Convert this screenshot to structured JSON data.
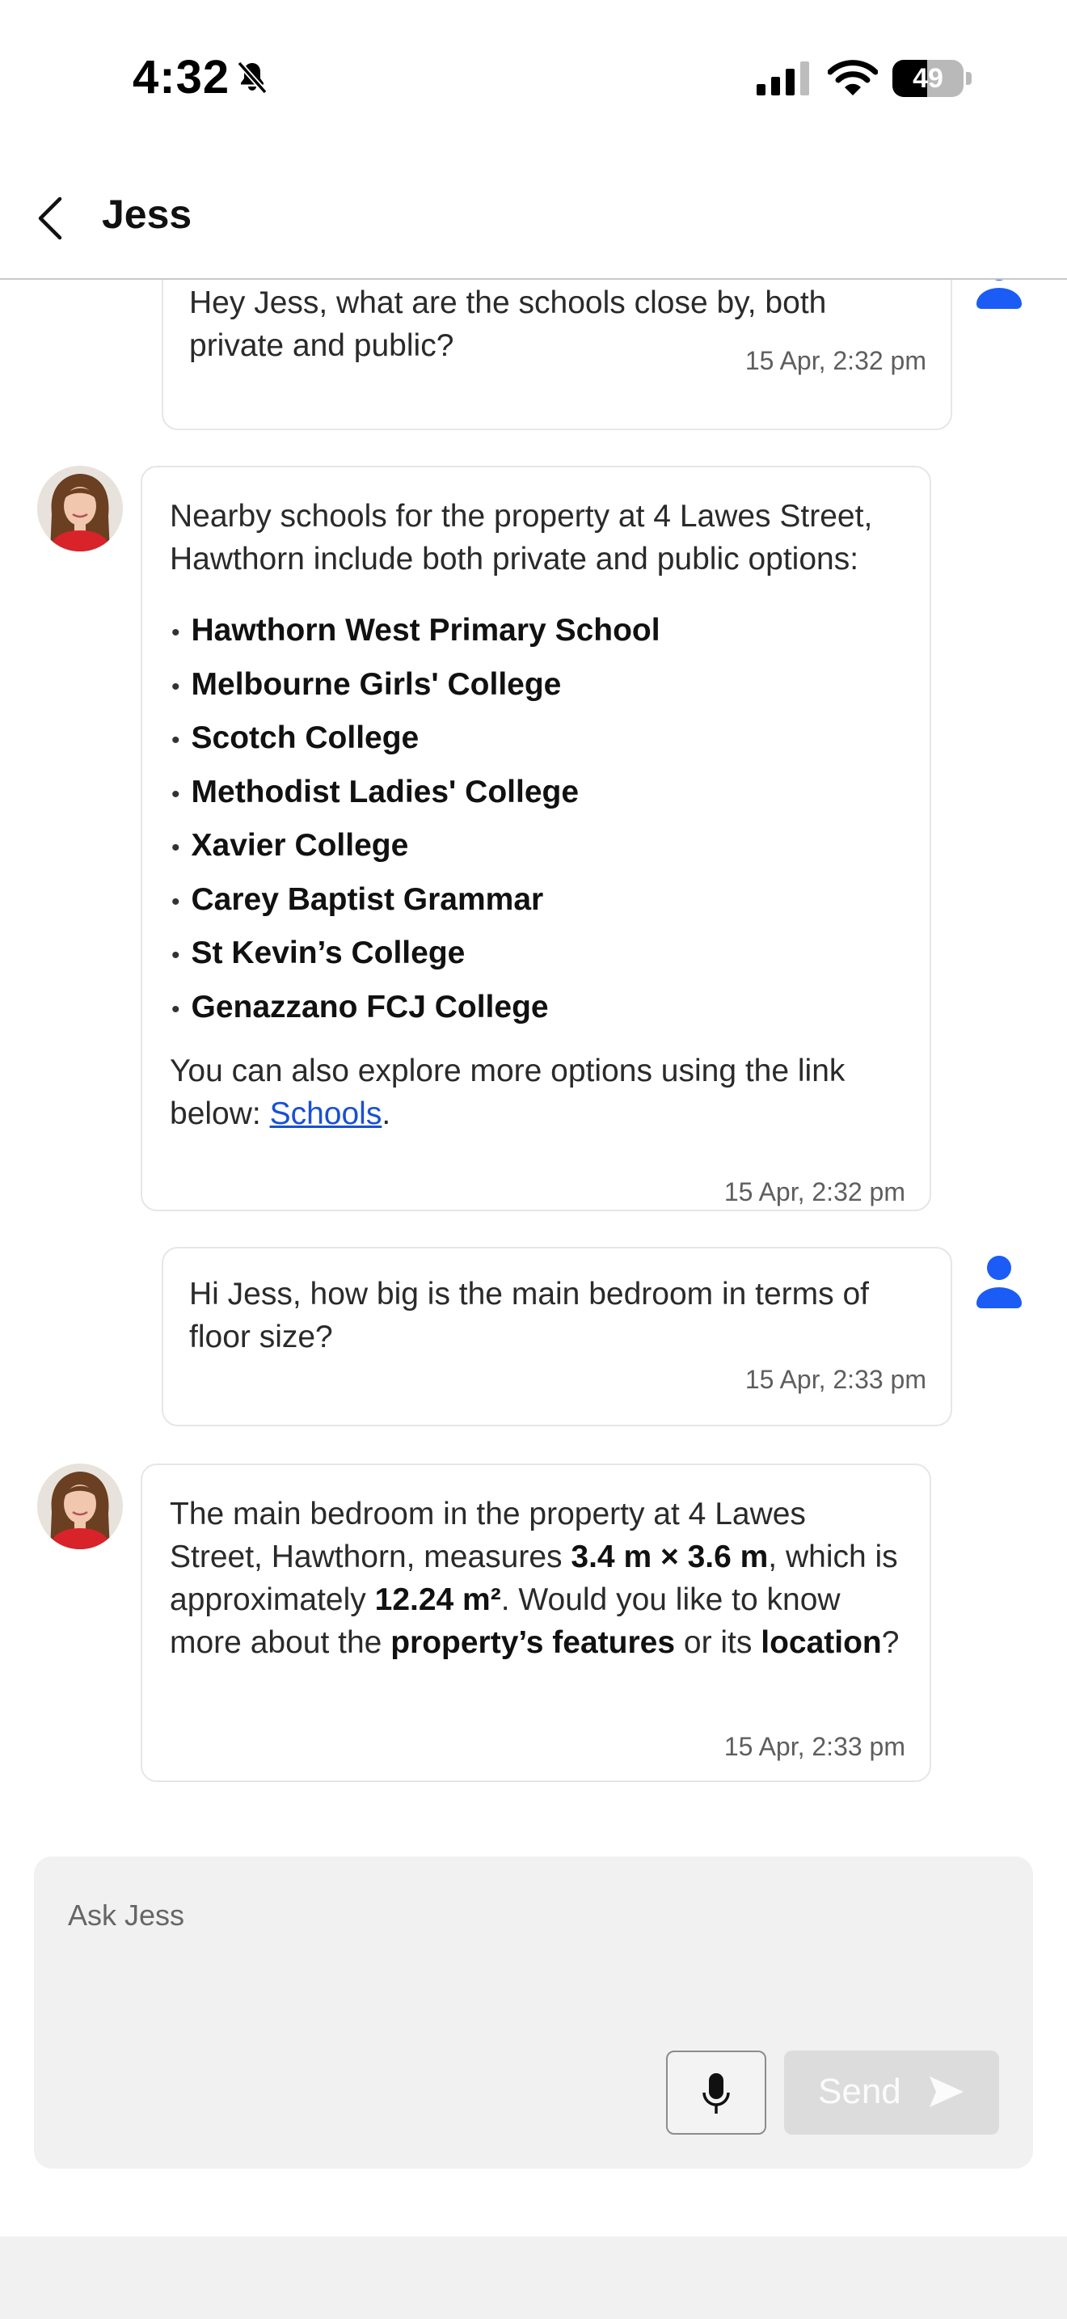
{
  "status_bar": {
    "time": "4:32",
    "battery": "49",
    "battery_level": 0.49
  },
  "header": {
    "title": "Jess"
  },
  "messages": [
    {
      "sender": "user",
      "text": "Hey Jess, what are the schools close by, both private and public?",
      "time": "15 Apr, 2:32 pm"
    },
    {
      "sender": "bot",
      "intro": "Nearby schools for the property at 4 Lawes Street, Hawthorn include both private and public options:",
      "schools": [
        "Hawthorn West Primary School",
        "Melbourne Girls' College",
        "Scotch College",
        "Methodist Ladies' College",
        "Xavier College",
        "Carey Baptist Grammar",
        "St Kevin’s College",
        "Genazzano FCJ College"
      ],
      "outro": "You can also explore more options using the link below:",
      "link_text": "Schools",
      "outro_end": ".",
      "time": "15 Apr, 2:32 pm"
    },
    {
      "sender": "user",
      "text": "Hi Jess, how big is the main bedroom in terms of floor size?",
      "time": "15 Apr, 2:33 pm"
    },
    {
      "sender": "bot",
      "part1": "The main bedroom in the property at 4 Lawes Street, Hawthorn, measures",
      "bold1": "3.4 m × 3.6 m",
      "part2": ", which is approximately",
      "bold2": "12.24 m²",
      "part3": ". Would you like to know more about the",
      "bold3": "property’s features",
      "part4": "or its",
      "bold4": "location",
      "part5": "?",
      "time": "15 Apr, 2:33 pm"
    }
  ],
  "composer": {
    "placeholder": "Ask Jess",
    "send_label": "Send"
  },
  "icons": {
    "back": "chevron-left-icon",
    "bell": "bell-slash-icon",
    "signal": "cellular-signal-icon",
    "wifi": "wifi-icon",
    "battery": "battery-icon",
    "user": "user-icon",
    "mic": "microphone-icon",
    "send": "send-icon"
  },
  "colors": {
    "accent": "#1a5cf5",
    "link": "#1a4fd6",
    "composer_bg": "#f1f1f1",
    "send_disabled": "#dcdcdc",
    "bot_avatar_dress": "#d8232a"
  }
}
